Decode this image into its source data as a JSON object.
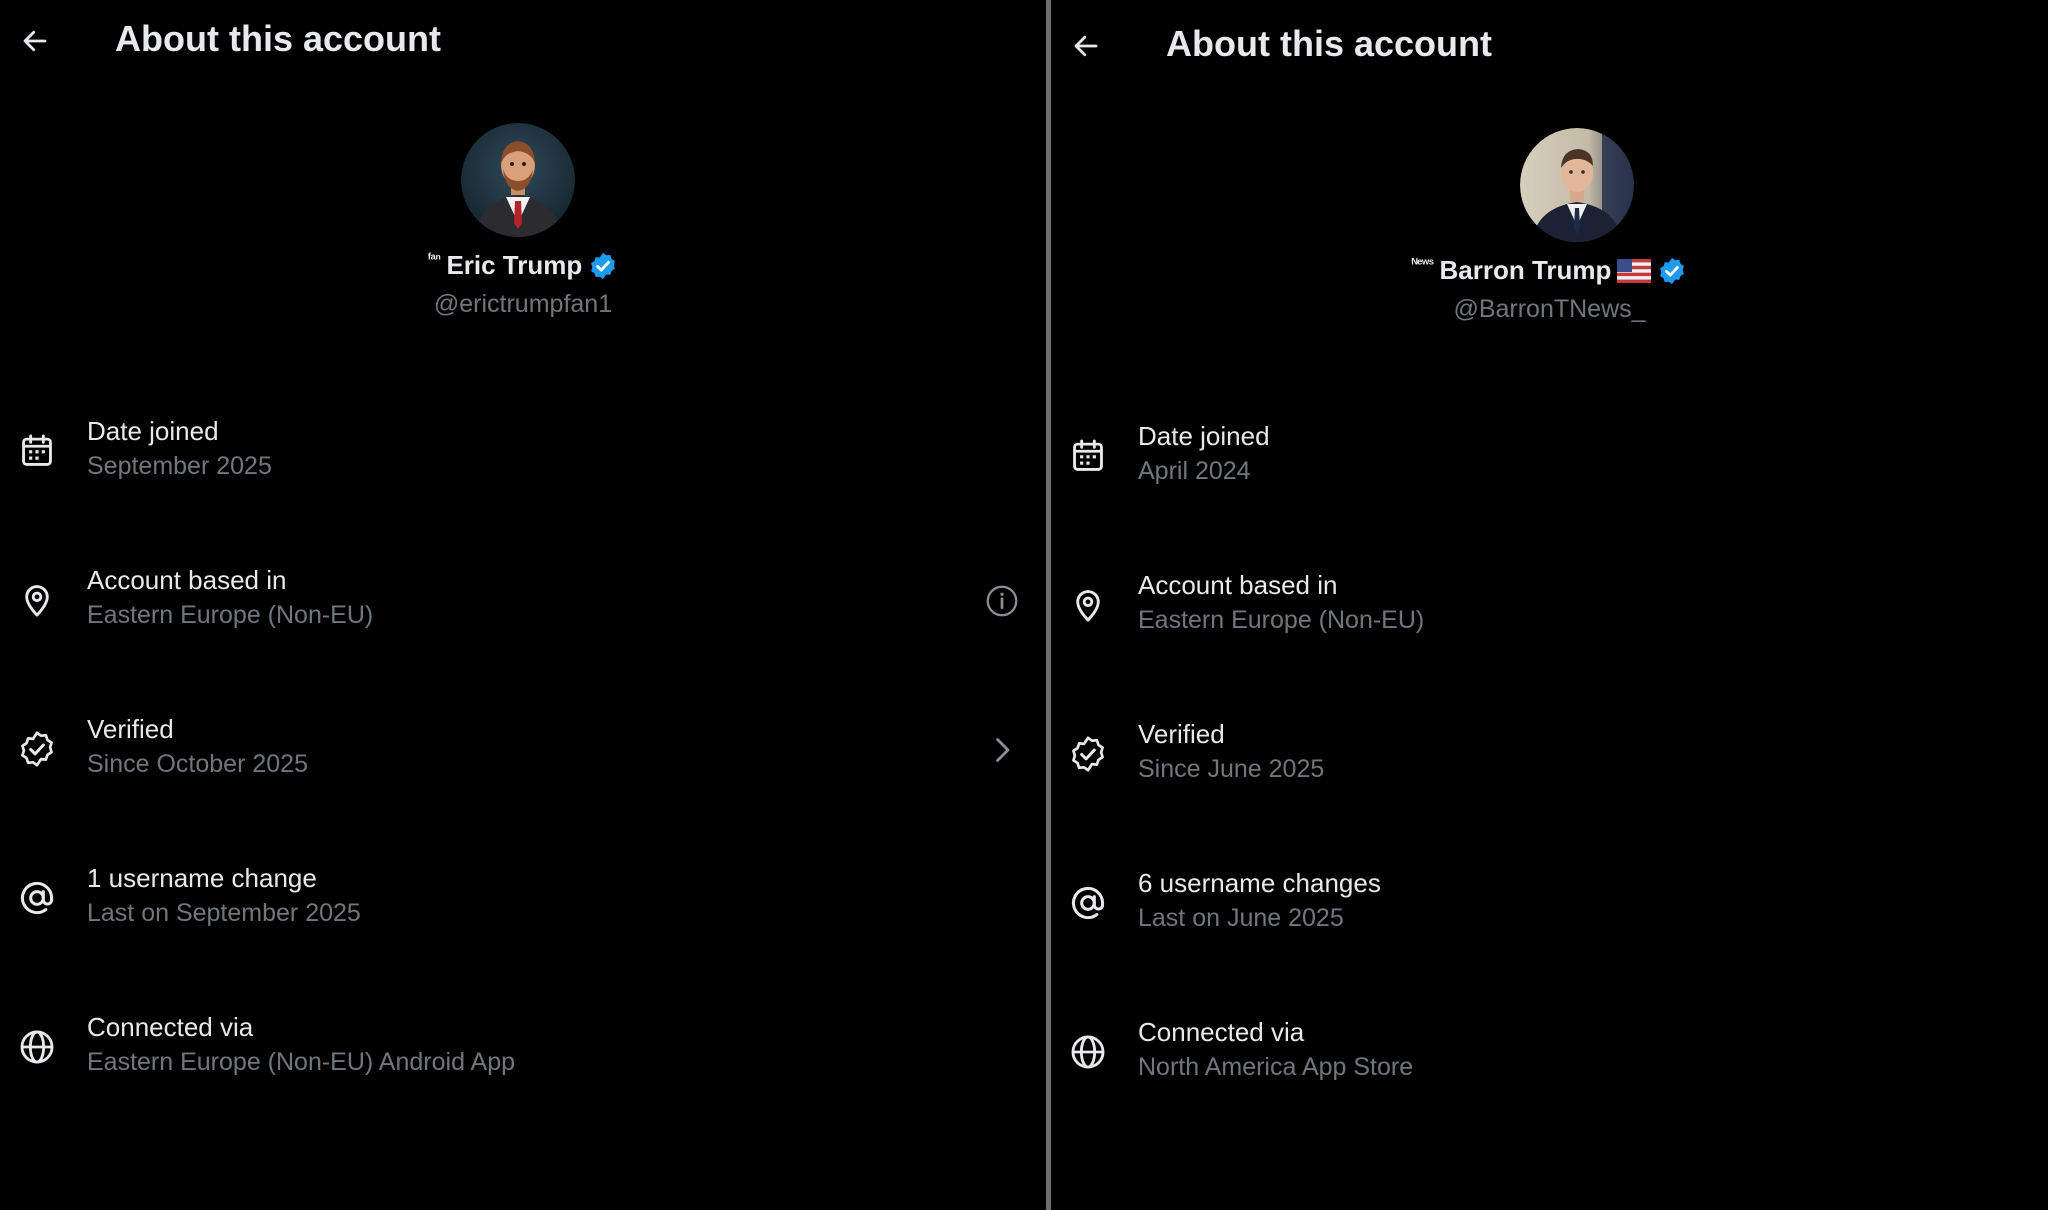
{
  "panels": [
    {
      "title": "About this account",
      "profile": {
        "name_prefix": "ᶠᵃⁿ",
        "display_name": "Eric Trump",
        "handle": "@erictrumpfan1",
        "verified": true,
        "has_flag": false,
        "avatar_icon": "cartoon-man-avatar"
      },
      "rows": [
        {
          "icon": "calendar-icon",
          "title": "Date joined",
          "subtitle": "September 2025"
        },
        {
          "icon": "location-pin-icon",
          "title": "Account based in",
          "subtitle": "Eastern Europe (Non-EU)",
          "trailing_icon": "info-circle-icon"
        },
        {
          "icon": "verified-check-icon",
          "title": "Verified",
          "subtitle": "Since October 2025",
          "trailing_icon": "chevron-right-icon"
        },
        {
          "icon": "at-sign-icon",
          "title": "1 username change",
          "subtitle": "Last on September 2025"
        },
        {
          "icon": "globe-icon",
          "title": "Connected via",
          "subtitle": "Eastern Europe (Non-EU) Android App"
        }
      ]
    },
    {
      "title": "About this account",
      "profile": {
        "name_prefix": "ᴺᵉʷˢ",
        "display_name": "Barron Trump",
        "handle": "@BarronTNews_",
        "verified": true,
        "has_flag": true,
        "avatar_icon": "man-in-suit-avatar"
      },
      "rows": [
        {
          "icon": "calendar-icon",
          "title": "Date joined",
          "subtitle": "April 2024"
        },
        {
          "icon": "location-pin-icon",
          "title": "Account based in",
          "subtitle": "Eastern Europe (Non-EU)"
        },
        {
          "icon": "verified-check-icon",
          "title": "Verified",
          "subtitle": "Since June 2025"
        },
        {
          "icon": "at-sign-icon",
          "title": "6 username changes",
          "subtitle": "Last on June 2025"
        },
        {
          "icon": "globe-icon",
          "title": "Connected via",
          "subtitle": "North America App Store"
        }
      ]
    }
  ],
  "colors": {
    "background": "#000000",
    "primary_text": "#e7e9ea",
    "secondary_text": "#71767b",
    "verified_blue": "#1d9bf0",
    "divider": "#6f6f6f"
  }
}
